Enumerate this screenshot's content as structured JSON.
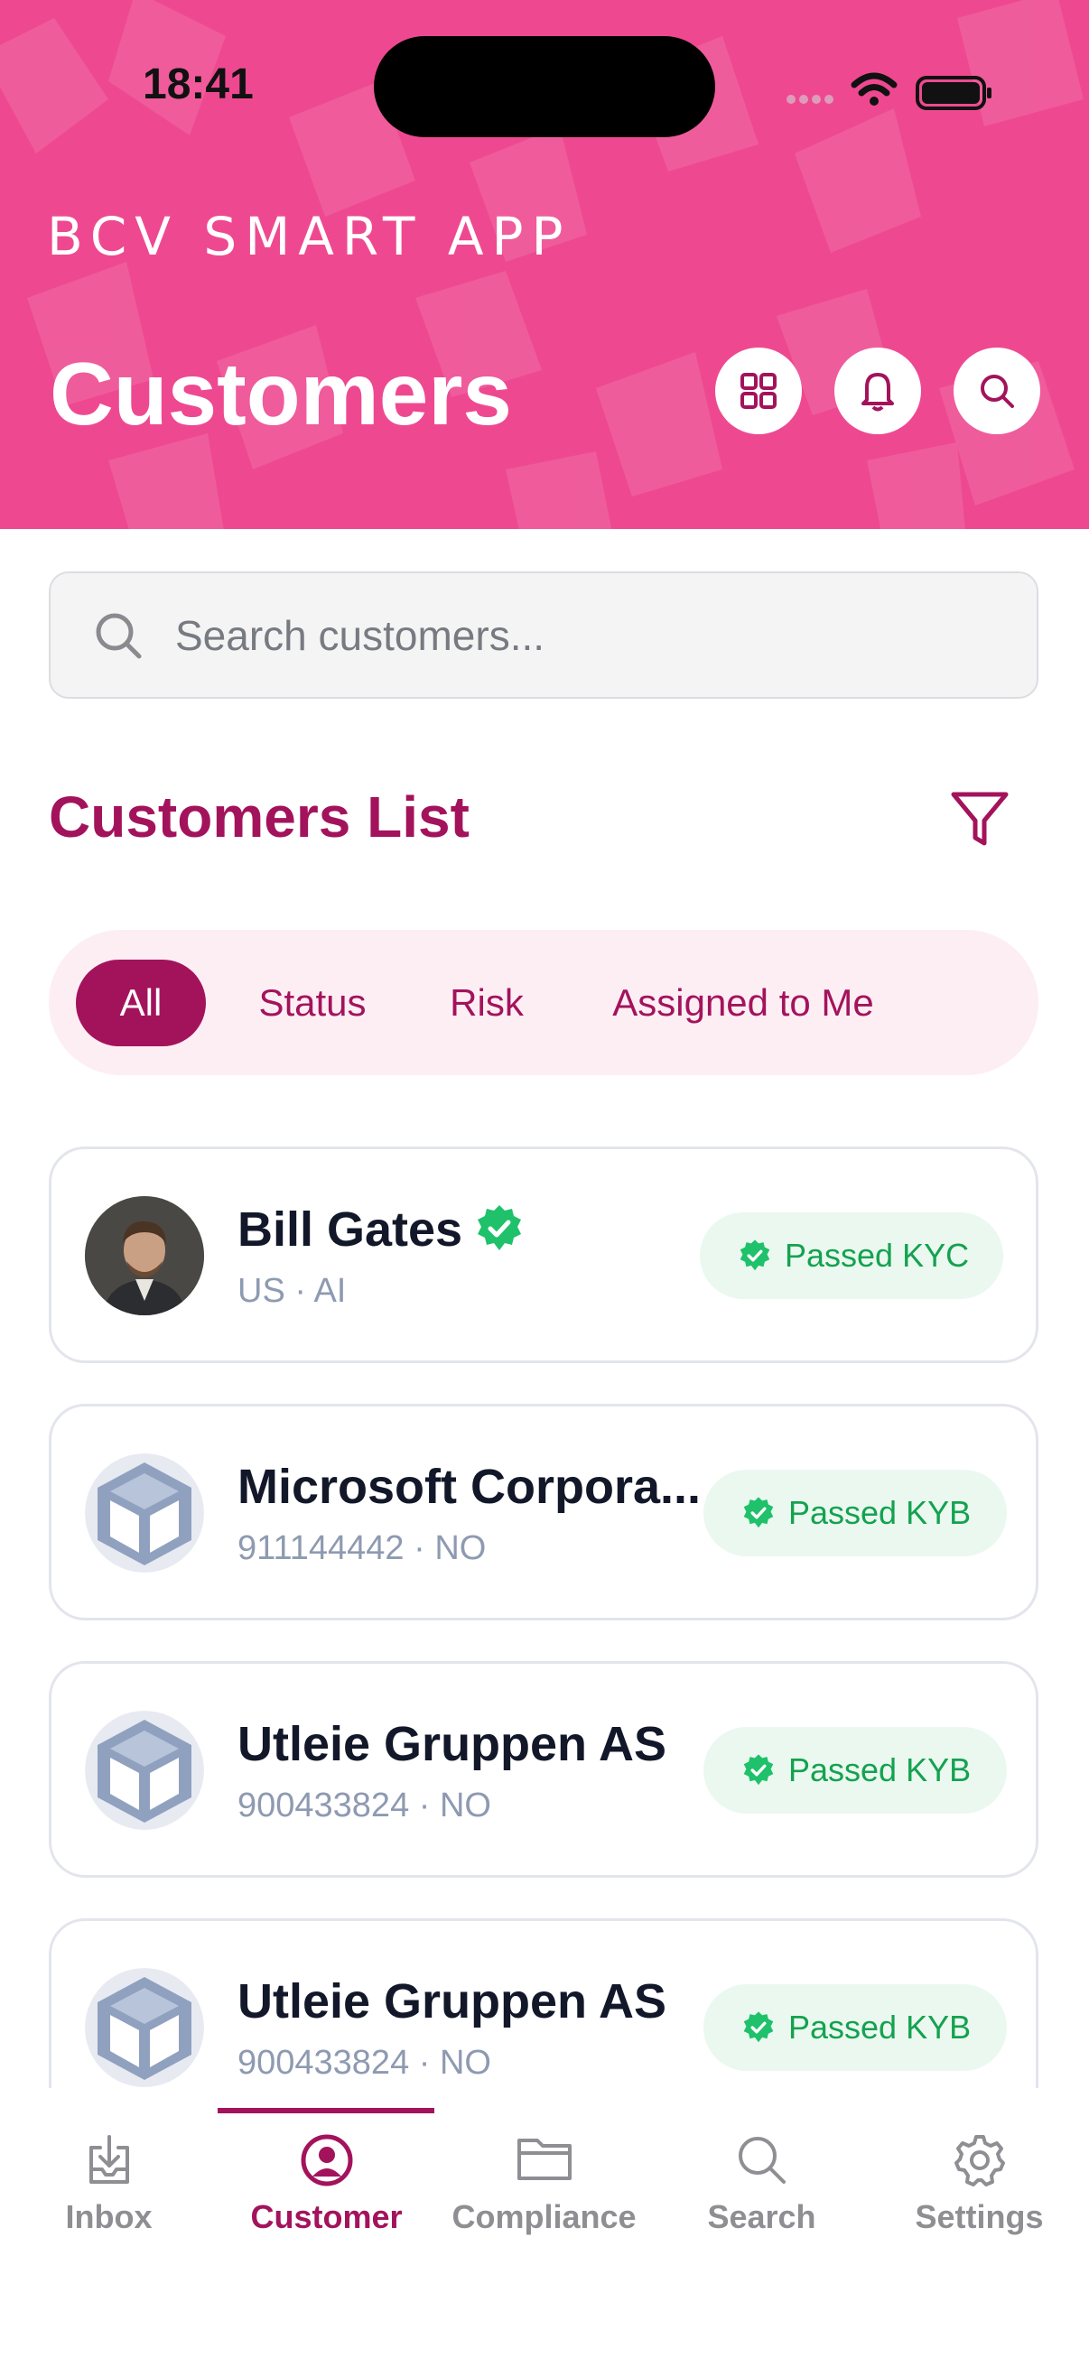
{
  "status_bar": {
    "time": "18:41"
  },
  "header": {
    "brand": "BCV SMART APP",
    "title": "Customers",
    "colors": {
      "background": "#ee4990",
      "accent": "#a3135c"
    },
    "actions": [
      {
        "name": "grid-icon"
      },
      {
        "name": "bell-icon"
      },
      {
        "name": "search-icon"
      }
    ]
  },
  "search": {
    "placeholder": "Search customers...",
    "value": ""
  },
  "list": {
    "title": "Customers List",
    "filter_icon": "filter-icon",
    "chips": [
      {
        "label": "All",
        "active": true
      },
      {
        "label": "Status",
        "active": false
      },
      {
        "label": "Risk",
        "active": false
      },
      {
        "label": "Assigned to Me",
        "active": false
      }
    ],
    "customers": [
      {
        "name": "Bill Gates",
        "sub": "US · AI",
        "verified": true,
        "status": "Passed KYC",
        "avatar": "person-photo"
      },
      {
        "name": "Microsoft Corpora...",
        "sub": "911144442 · NO",
        "verified": false,
        "status": "Passed KYB",
        "avatar": "company-box-icon"
      },
      {
        "name": "Utleie Gruppen AS",
        "sub": "900433824 · NO",
        "verified": false,
        "status": "Passed KYB",
        "avatar": "company-box-icon"
      },
      {
        "name": "Utleie Gruppen AS",
        "sub": "900433824 · NO",
        "verified": false,
        "status": "Passed KYB",
        "avatar": "company-box-icon"
      }
    ]
  },
  "tabbar": {
    "tabs": [
      {
        "label": "Inbox",
        "icon": "inbox-icon",
        "active": false
      },
      {
        "label": "Customer",
        "icon": "user-circle-icon",
        "active": true
      },
      {
        "label": "Compliance",
        "icon": "folder-icon",
        "active": false
      },
      {
        "label": "Search",
        "icon": "search-icon",
        "active": false
      },
      {
        "label": "Settings",
        "icon": "gear-icon",
        "active": false
      }
    ]
  }
}
